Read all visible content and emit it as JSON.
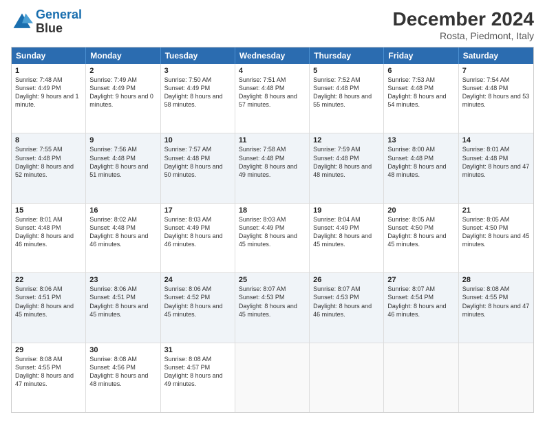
{
  "header": {
    "logo_line1": "General",
    "logo_line2": "Blue",
    "main_title": "December 2024",
    "subtitle": "Rosta, Piedmont, Italy"
  },
  "days_of_week": [
    "Sunday",
    "Monday",
    "Tuesday",
    "Wednesday",
    "Thursday",
    "Friday",
    "Saturday"
  ],
  "weeks": [
    [
      {
        "day": 1,
        "rise": "7:48 AM",
        "set": "4:49 PM",
        "daylight": "9 hours and 1 minute."
      },
      {
        "day": 2,
        "rise": "7:49 AM",
        "set": "4:49 PM",
        "daylight": "9 hours and 0 minutes."
      },
      {
        "day": 3,
        "rise": "7:50 AM",
        "set": "4:49 PM",
        "daylight": "8 hours and 58 minutes."
      },
      {
        "day": 4,
        "rise": "7:51 AM",
        "set": "4:48 PM",
        "daylight": "8 hours and 57 minutes."
      },
      {
        "day": 5,
        "rise": "7:52 AM",
        "set": "4:48 PM",
        "daylight": "8 hours and 55 minutes."
      },
      {
        "day": 6,
        "rise": "7:53 AM",
        "set": "4:48 PM",
        "daylight": "8 hours and 54 minutes."
      },
      {
        "day": 7,
        "rise": "7:54 AM",
        "set": "4:48 PM",
        "daylight": "8 hours and 53 minutes."
      }
    ],
    [
      {
        "day": 8,
        "rise": "7:55 AM",
        "set": "4:48 PM",
        "daylight": "8 hours and 52 minutes."
      },
      {
        "day": 9,
        "rise": "7:56 AM",
        "set": "4:48 PM",
        "daylight": "8 hours and 51 minutes."
      },
      {
        "day": 10,
        "rise": "7:57 AM",
        "set": "4:48 PM",
        "daylight": "8 hours and 50 minutes."
      },
      {
        "day": 11,
        "rise": "7:58 AM",
        "set": "4:48 PM",
        "daylight": "8 hours and 49 minutes."
      },
      {
        "day": 12,
        "rise": "7:59 AM",
        "set": "4:48 PM",
        "daylight": "8 hours and 48 minutes."
      },
      {
        "day": 13,
        "rise": "8:00 AM",
        "set": "4:48 PM",
        "daylight": "8 hours and 48 minutes."
      },
      {
        "day": 14,
        "rise": "8:01 AM",
        "set": "4:48 PM",
        "daylight": "8 hours and 47 minutes."
      }
    ],
    [
      {
        "day": 15,
        "rise": "8:01 AM",
        "set": "4:48 PM",
        "daylight": "8 hours and 46 minutes."
      },
      {
        "day": 16,
        "rise": "8:02 AM",
        "set": "4:48 PM",
        "daylight": "8 hours and 46 minutes."
      },
      {
        "day": 17,
        "rise": "8:03 AM",
        "set": "4:49 PM",
        "daylight": "8 hours and 46 minutes."
      },
      {
        "day": 18,
        "rise": "8:03 AM",
        "set": "4:49 PM",
        "daylight": "8 hours and 45 minutes."
      },
      {
        "day": 19,
        "rise": "8:04 AM",
        "set": "4:49 PM",
        "daylight": "8 hours and 45 minutes."
      },
      {
        "day": 20,
        "rise": "8:05 AM",
        "set": "4:50 PM",
        "daylight": "8 hours and 45 minutes."
      },
      {
        "day": 21,
        "rise": "8:05 AM",
        "set": "4:50 PM",
        "daylight": "8 hours and 45 minutes."
      }
    ],
    [
      {
        "day": 22,
        "rise": "8:06 AM",
        "set": "4:51 PM",
        "daylight": "8 hours and 45 minutes."
      },
      {
        "day": 23,
        "rise": "8:06 AM",
        "set": "4:51 PM",
        "daylight": "8 hours and 45 minutes."
      },
      {
        "day": 24,
        "rise": "8:06 AM",
        "set": "4:52 PM",
        "daylight": "8 hours and 45 minutes."
      },
      {
        "day": 25,
        "rise": "8:07 AM",
        "set": "4:53 PM",
        "daylight": "8 hours and 45 minutes."
      },
      {
        "day": 26,
        "rise": "8:07 AM",
        "set": "4:53 PM",
        "daylight": "8 hours and 46 minutes."
      },
      {
        "day": 27,
        "rise": "8:07 AM",
        "set": "4:54 PM",
        "daylight": "8 hours and 46 minutes."
      },
      {
        "day": 28,
        "rise": "8:08 AM",
        "set": "4:55 PM",
        "daylight": "8 hours and 47 minutes."
      }
    ],
    [
      {
        "day": 29,
        "rise": "8:08 AM",
        "set": "4:55 PM",
        "daylight": "8 hours and 47 minutes."
      },
      {
        "day": 30,
        "rise": "8:08 AM",
        "set": "4:56 PM",
        "daylight": "8 hours and 48 minutes."
      },
      {
        "day": 31,
        "rise": "8:08 AM",
        "set": "4:57 PM",
        "daylight": "8 hours and 49 minutes."
      },
      null,
      null,
      null,
      null
    ]
  ]
}
